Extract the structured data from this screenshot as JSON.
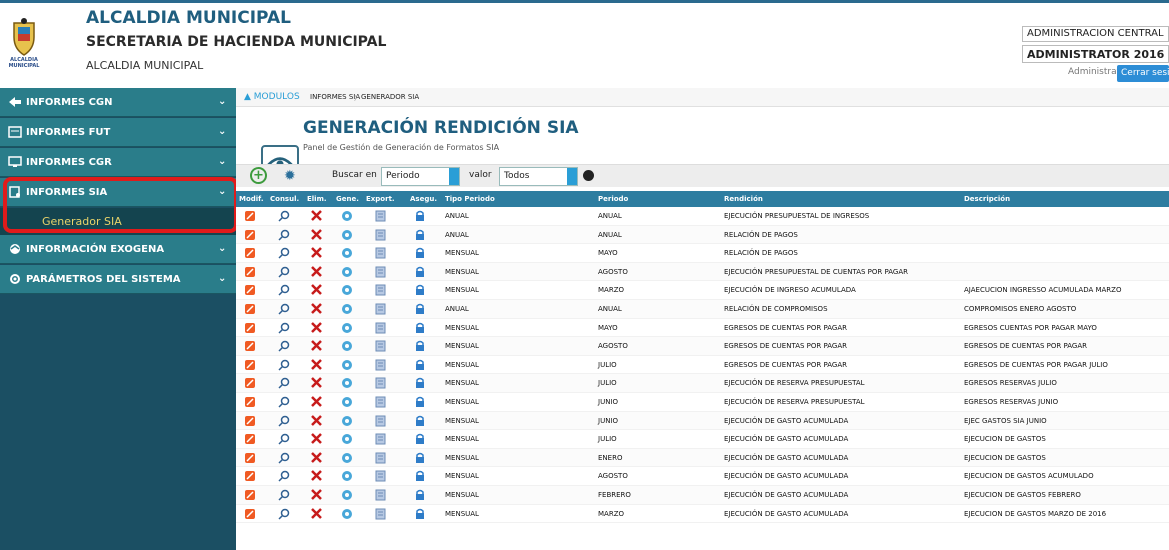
{
  "header": {
    "title": "ALCALDIA MUNICIPAL",
    "subtitle": "SECRETARIA DE HACIENDA MUNICIPAL",
    "small": "ALCALDIA MUNICIPAL",
    "logo_caption": "ALCALDIA MUNICIPAL",
    "entity": "ADMINISTRACION CENTRAL",
    "user_year": "ADMINISTRATOR 2016",
    "role": "Administrator",
    "logout": "Cerrar sesión"
  },
  "sidebar": {
    "items": [
      {
        "label": "INFORMES CGN",
        "icon": "arrow-icon"
      },
      {
        "label": "INFORMES FUT",
        "icon": "document-icon"
      },
      {
        "label": "INFORMES CGR",
        "icon": "monitor-icon"
      },
      {
        "label": "INFORMES SIA",
        "icon": "report-icon"
      },
      {
        "label": "INFORMACIÓN EXOGENA",
        "icon": "data-icon"
      },
      {
        "label": "PARÁMETROS DEL SISTEMA",
        "icon": "gear-icon"
      }
    ],
    "subitem": "Generador SIA",
    "colors": {
      "panel": "#1b4f63",
      "item": "#2a7d8a",
      "sub": "#14444f",
      "sub_text": "#e8d36a",
      "highlight": "#e01b1b"
    }
  },
  "breadcrumb": [
    "MODULOS",
    "INFORMES SIA",
    "GENERADOR SIA"
  ],
  "page": {
    "title": "GENERACIÓN RENDICIÓN SIA",
    "subtitle": "Panel de Gestión de Generación de Formatos SIA"
  },
  "toolbar": {
    "search_label": "Buscar en",
    "search_value": "Periodo",
    "value_label": "valor",
    "value_value": "Todos"
  },
  "table": {
    "columns": [
      "Modif.",
      "Consul.",
      "Elim.",
      "Gene.",
      "Export.",
      "Asegu.",
      "Tipo Periodo",
      "Periodo",
      "Rendición",
      "Descripción"
    ],
    "rows": [
      [
        "ANUAL",
        "ANUAL",
        "EJECUCIÓN PRESUPUESTAL DE INGRESOS",
        ""
      ],
      [
        "ANUAL",
        "ANUAL",
        "RELACIÓN DE PAGOS",
        ""
      ],
      [
        "MENSUAL",
        "MAYO",
        "RELACIÓN DE PAGOS",
        ""
      ],
      [
        "MENSUAL",
        "AGOSTO",
        "EJECUCIÓN PRESUPUESTAL DE CUENTAS POR PAGAR",
        ""
      ],
      [
        "MENSUAL",
        "MARZO",
        "EJECUCIÓN DE INGRESO ACUMULADA",
        "AJAECUCION INGRESSO ACUMULADA MARZO"
      ],
      [
        "ANUAL",
        "ANUAL",
        "RELACIÓN DE COMPROMISOS",
        "COMPROMISOS ENERO AGOSTO"
      ],
      [
        "MENSUAL",
        "MAYO",
        "EGRESOS DE CUENTAS POR PAGAR",
        "EGRESOS CUENTAS POR PAGAR MAYO"
      ],
      [
        "MENSUAL",
        "AGOSTO",
        "EGRESOS DE CUENTAS POR PAGAR",
        "EGRESOS DE CUENTAS POR PAGAR"
      ],
      [
        "MENSUAL",
        "JULIO",
        "EGRESOS DE CUENTAS POR PAGAR",
        "EGRESOS DE CUENTAS POR PAGAR JULIO"
      ],
      [
        "MENSUAL",
        "JULIO",
        "EJECUCIÓN DE RESERVA PRESUPUESTAL",
        "EGRESOS RESERVAS JULIO"
      ],
      [
        "MENSUAL",
        "JUNIO",
        "EJECUCIÓN DE RESERVA PRESUPUESTAL",
        "EGRESOS RESERVAS JUNIO"
      ],
      [
        "MENSUAL",
        "JUNIO",
        "EJECUCIÓN DE GASTO ACUMULADA",
        "EJEC GASTOS SIA JUNIO"
      ],
      [
        "MENSUAL",
        "JULIO",
        "EJECUCIÓN DE GASTO ACUMULADA",
        "EJECUCION DE GASTOS"
      ],
      [
        "MENSUAL",
        "ENERO",
        "EJECUCIÓN DE GASTO ACUMULADA",
        "EJECUCION DE GASTOS"
      ],
      [
        "MENSUAL",
        "AGOSTO",
        "EJECUCIÓN DE GASTO ACUMULADA",
        "EJECUCION DE GASTOS ACUMULADO"
      ],
      [
        "MENSUAL",
        "FEBRERO",
        "EJECUCIÓN DE GASTO ACUMULADA",
        "EJECUCION DE GASTOS FEBRERO"
      ],
      [
        "MENSUAL",
        "MARZO",
        "EJECUCIÓN DE GASTO ACUMULADA",
        "EJECUCION DE GASTOS MARZO DE 2016"
      ]
    ]
  }
}
